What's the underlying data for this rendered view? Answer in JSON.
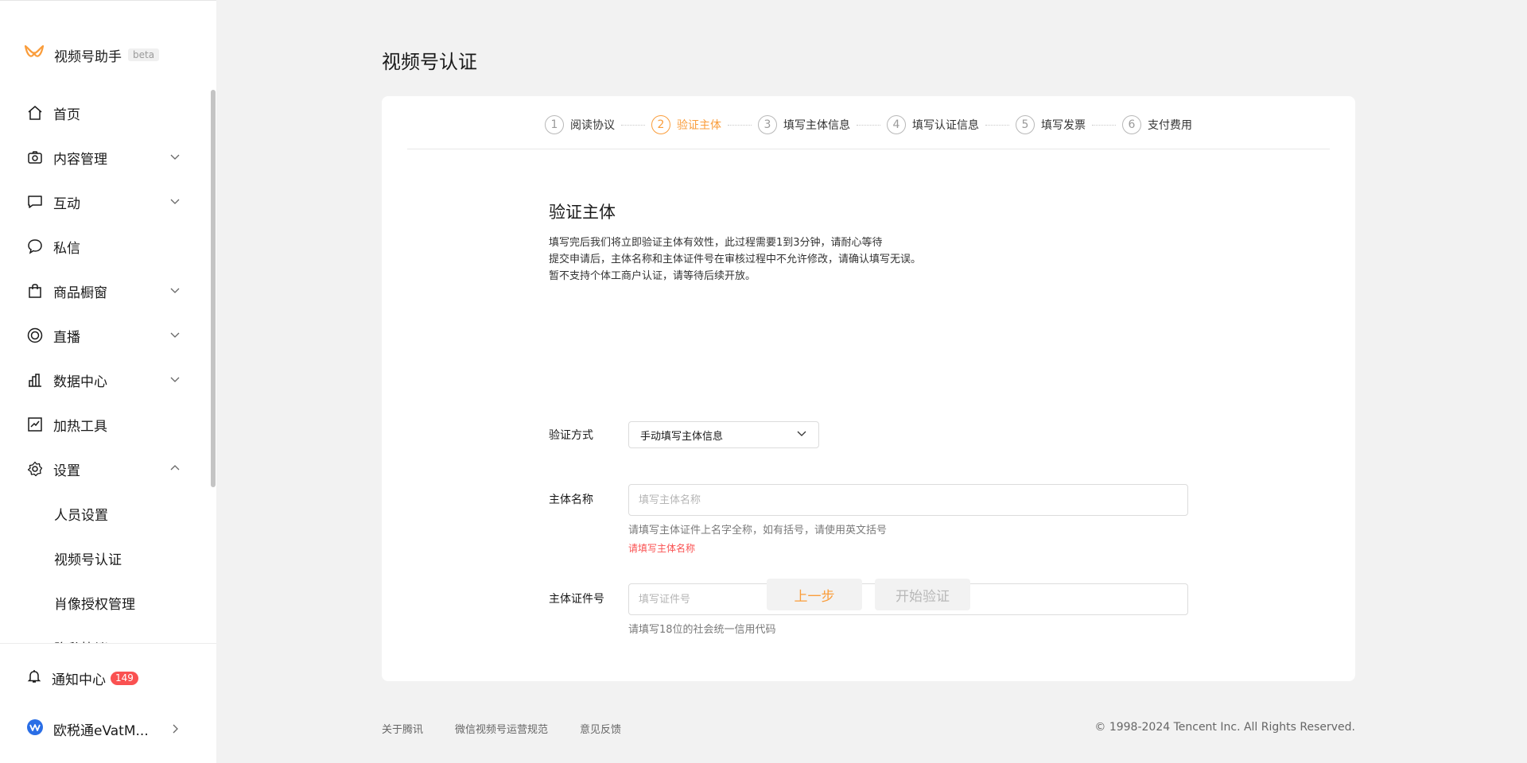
{
  "brand": {
    "name": "视频号助手",
    "tag": "beta"
  },
  "sidebar": {
    "items": [
      {
        "label": "首页",
        "icon": "home-icon",
        "expandable": false
      },
      {
        "label": "内容管理",
        "icon": "camera-icon",
        "expandable": true
      },
      {
        "label": "互动",
        "icon": "chat-square-icon",
        "expandable": true
      },
      {
        "label": "私信",
        "icon": "message-bubble-icon",
        "expandable": false
      },
      {
        "label": "商品橱窗",
        "icon": "shopping-bag-icon",
        "expandable": true
      },
      {
        "label": "直播",
        "icon": "live-ring-icon",
        "expandable": true
      },
      {
        "label": "数据中心",
        "icon": "bar-chart-icon",
        "expandable": true
      },
      {
        "label": "加热工具",
        "icon": "trend-chart-icon",
        "expandable": false
      },
      {
        "label": "设置",
        "icon": "gear-icon",
        "expandable": true,
        "expanded": true
      }
    ],
    "sub_items": [
      "人员设置",
      "视频号认证",
      "肖像授权管理",
      "隐私协议"
    ],
    "notification": {
      "label": "通知中心",
      "count": "149"
    },
    "account": {
      "label": "欧税通eVatM..."
    }
  },
  "main": {
    "title": "视频号认证",
    "steps": [
      {
        "num": "1",
        "label": "阅读协议",
        "active": false
      },
      {
        "num": "2",
        "label": "验证主体",
        "active": true
      },
      {
        "num": "3",
        "label": "填写主体信息",
        "active": false
      },
      {
        "num": "4",
        "label": "填写认证信息",
        "active": false
      },
      {
        "num": "5",
        "label": "填写发票",
        "active": false
      },
      {
        "num": "6",
        "label": "支付费用",
        "active": false
      }
    ],
    "section": {
      "title": "验证主体",
      "desc": [
        "填写完后我们将立即验证主体有效性，此过程需要1到3分钟，请耐心等待",
        "提交申请后，主体名称和主体证件号在审核过程中不允许修改，请确认填写无误。",
        "暂不支持个体工商户认证，请等待后续开放。"
      ]
    },
    "form": {
      "method_label": "验证方式",
      "method_value": "手动填写主体信息",
      "name_label": "主体名称",
      "name_placeholder": "填写主体名称",
      "name_hint": "请填写主体证件上名字全称，如有括号，请使用英文括号",
      "name_error": "请填写主体名称",
      "id_label": "主体证件号",
      "id_placeholder": "填写证件号",
      "id_hint": "请填写18位的社会统一信用代码"
    },
    "buttons": {
      "prev": "上一步",
      "start": "开始验证"
    }
  },
  "footer": {
    "links": [
      "关于腾讯",
      "微信视频号运营规范",
      "意见反馈"
    ],
    "copyright": "© 1998-2024 Tencent Inc. All Rights Reserved."
  },
  "colors": {
    "accent": "#fa9d3b",
    "error": "#fa5151",
    "badge": "#fa5151"
  }
}
